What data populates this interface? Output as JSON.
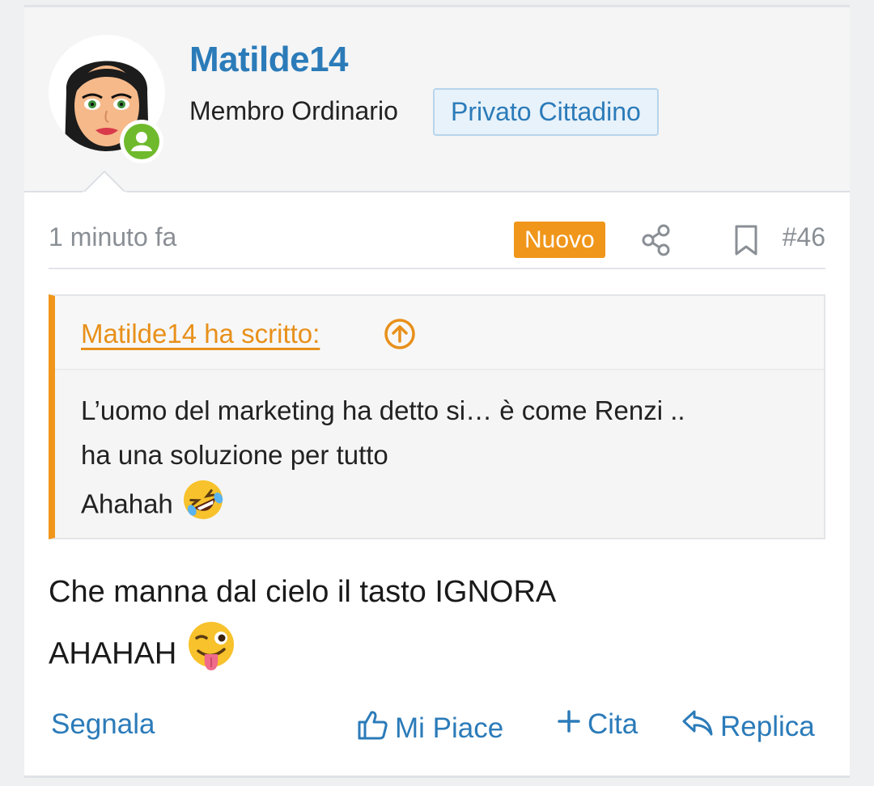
{
  "user": {
    "name": "Matilde14",
    "title": "Membro Ordinario",
    "banner": "Privato Cittadino",
    "status": "online"
  },
  "meta": {
    "time": "1 minuto fa",
    "new_label": "Nuovo",
    "post_number": "#46"
  },
  "quote": {
    "author_label": "Matilde14 ha scritto:",
    "lines": [
      "L’uomo del marketing ha detto si… è come Renzi ..",
      "ha una soluzione per tutto",
      "Ahahah"
    ]
  },
  "body": {
    "lines": [
      "Che manna dal cielo il tasto IGNORA",
      "AHAHAH"
    ]
  },
  "actions": {
    "report": "Segnala",
    "like": "Mi Piace",
    "quote": "Cita",
    "reply": "Replica"
  },
  "colors": {
    "accent": "#2b7bb9",
    "new_badge": "#f0961a",
    "quote_border": "#f0961a",
    "online": "#6fba2c"
  }
}
